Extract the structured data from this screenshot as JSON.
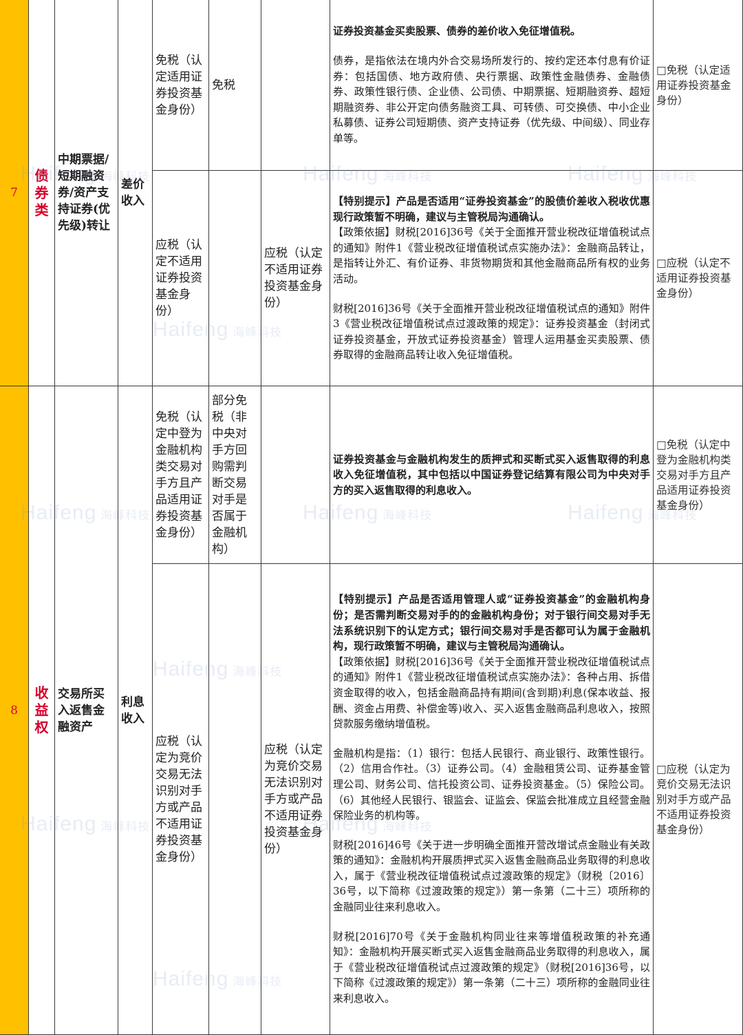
{
  "rows": [
    {
      "number": "7",
      "category": "债券类",
      "asset": "中期票据/短期融资券/资产支持证券(优先级)转让",
      "income_type": "差价收入",
      "sub1": {
        "status": "免税（认定适用证券投资基金身份）",
        "tax": "免税",
        "note": "",
        "paragraphs": [
          "证券投资基金买卖股票、债券的差价收入免征增值税。",
          "债券，是指依法在境内外合交易场所发行的、按约定还本付息有价证券：包括国债、地方政府债、央行票据、政策性金融债券、金融债券、政策性银行债、企业债、公司债、中期票据、短期融资券、超短期融资券、非公开定向债务融资工具、可转债、可交换债、中小企业私募债、证券公司短期债、资产支持证券（优先级、中间级）、同业存单等。"
        ],
        "option": "□免税（认定适用证券投资基金身份）"
      },
      "sub2": {
        "status": "应税（认定不适用证券投资基金身份）",
        "tax": "",
        "note": "应税（认定不适用证券投资基金身份）",
        "paragraphs": [
          "【特别提示】产品是否适用“证券投资基金”的股债价差收入税收优惠现行政策暂不明确，建议与主管税局沟通确认。",
          "【政策依据】财税[2016]36号《关于全面推开营业税改征增值税试点的通知》附件1《营业税改征增值税试点实施办法》：金融商品转让，是指转让外汇、有价证券、非货物期货和其他金融商品所有权的业务活动。",
          "财税[2016]36号《关于全面推开营业税改征增值税试点的通知》附件3《营业税改征增值税试点过渡政策的规定》：证券投资基金（封闭式证券投资基金，开放式证券投资基金）管理人运用基金买卖股票、债券取得的金融商品转让收入免征增值税。"
        ],
        "option": "□应税（认定不适用证券投资基金身份）"
      }
    },
    {
      "number": "8",
      "category": "收益权",
      "asset": "交易所买入返售金融资产",
      "income_type": "利息收入",
      "sub1": {
        "status": "免税（认定中登为金融机构类交易对手方且产品适用证券投资基金身份）",
        "tax": "部分免税（非中央对手方回购需判断交易对手是否属于金融机构）",
        "note": "",
        "paragraphs": [
          "证券投资基金与金融机构发生的质押式和买断式买入返售取得的利息收入免征增值税，其中包括以中国证券登记结算有限公司为中央对手方的买入返售取得的利息收入。"
        ],
        "option": "□免税（认定中登为金融机构类交易对手方且产品适用证券投资基金身份）"
      },
      "sub2": {
        "status": "应税（认定为竞价交易无法识别对手方或产品不适用证券投资基金身份）",
        "tax": "",
        "note": "应税（认定为竞价交易无法识别对手方或产品不适用证券投资基金身份）",
        "paragraphs": [
          "【特别提示】产品是否适用管理人或“证券投资基金”的金融机构身份；是否需判断交易对手的的金融机构身份；对于银行间交易对手无法系统识别下的认定方式；银行间交易对手是否都可认为属于金融机构，现行政策暂不明确，建议与主管税局沟通确认。",
          "【政策依据】财税[2016]36号《关于全面推开营业税改征增值税试点的通知》附件1《营业税改征增值税试点实施办法》：各种占用、拆借资金取得的收入，包括金融商品持有期间(含到期)利息(保本收益、报酬、资金占用费、补偿金等)收入、买入返售金融商品利息收入，按照贷款服务缴纳增值税。",
          "金融机构是指：（1）银行：包括人民银行、商业银行、政策性银行。（2）信用合作社。（3）证券公司。（4）金融租赁公司、证券基金管理公司、财务公司、信托投资公司、证券投资基金。（5）保险公司。（6）其他经人民银行、银监会、证监会、保监会批准成立且经营金融保险业务的机构等。",
          "财税[2016]46号《关于进一步明确全面推开营改增试点金融业有关政策的通知》：金融机构开展质押式买入返售金融商品业务取得的利息收入，属于《营业税改征增值税试点过渡政策的规定》（财税〔2016〕36号，以下简称《过渡政策的规定》）第一条第（二十三）项所称的金融同业往来利息收入。",
          "财税[2016]70号《关于金融机构同业往来等增值税政策的补充通知》：金融机构开展买断式买入返售金融商品业务取得的利息收入，属于《营业税改征增值税试点过渡政策的规定》（财税[2016]36号，以下简称《过渡政策的规定》）第一条第（二十三）项所称的金融同业往来利息收入。"
        ],
        "option": "□应税（认定为竞价交易无法识别对手方或产品不适用证券投资基金身份）"
      }
    }
  ],
  "watermark": {
    "text": "Haifeng",
    "cn": "海峰科技"
  },
  "colors": {
    "number_bg": "#ffc000",
    "category_text": "#d6002a",
    "border": "#3a3a3a"
  }
}
